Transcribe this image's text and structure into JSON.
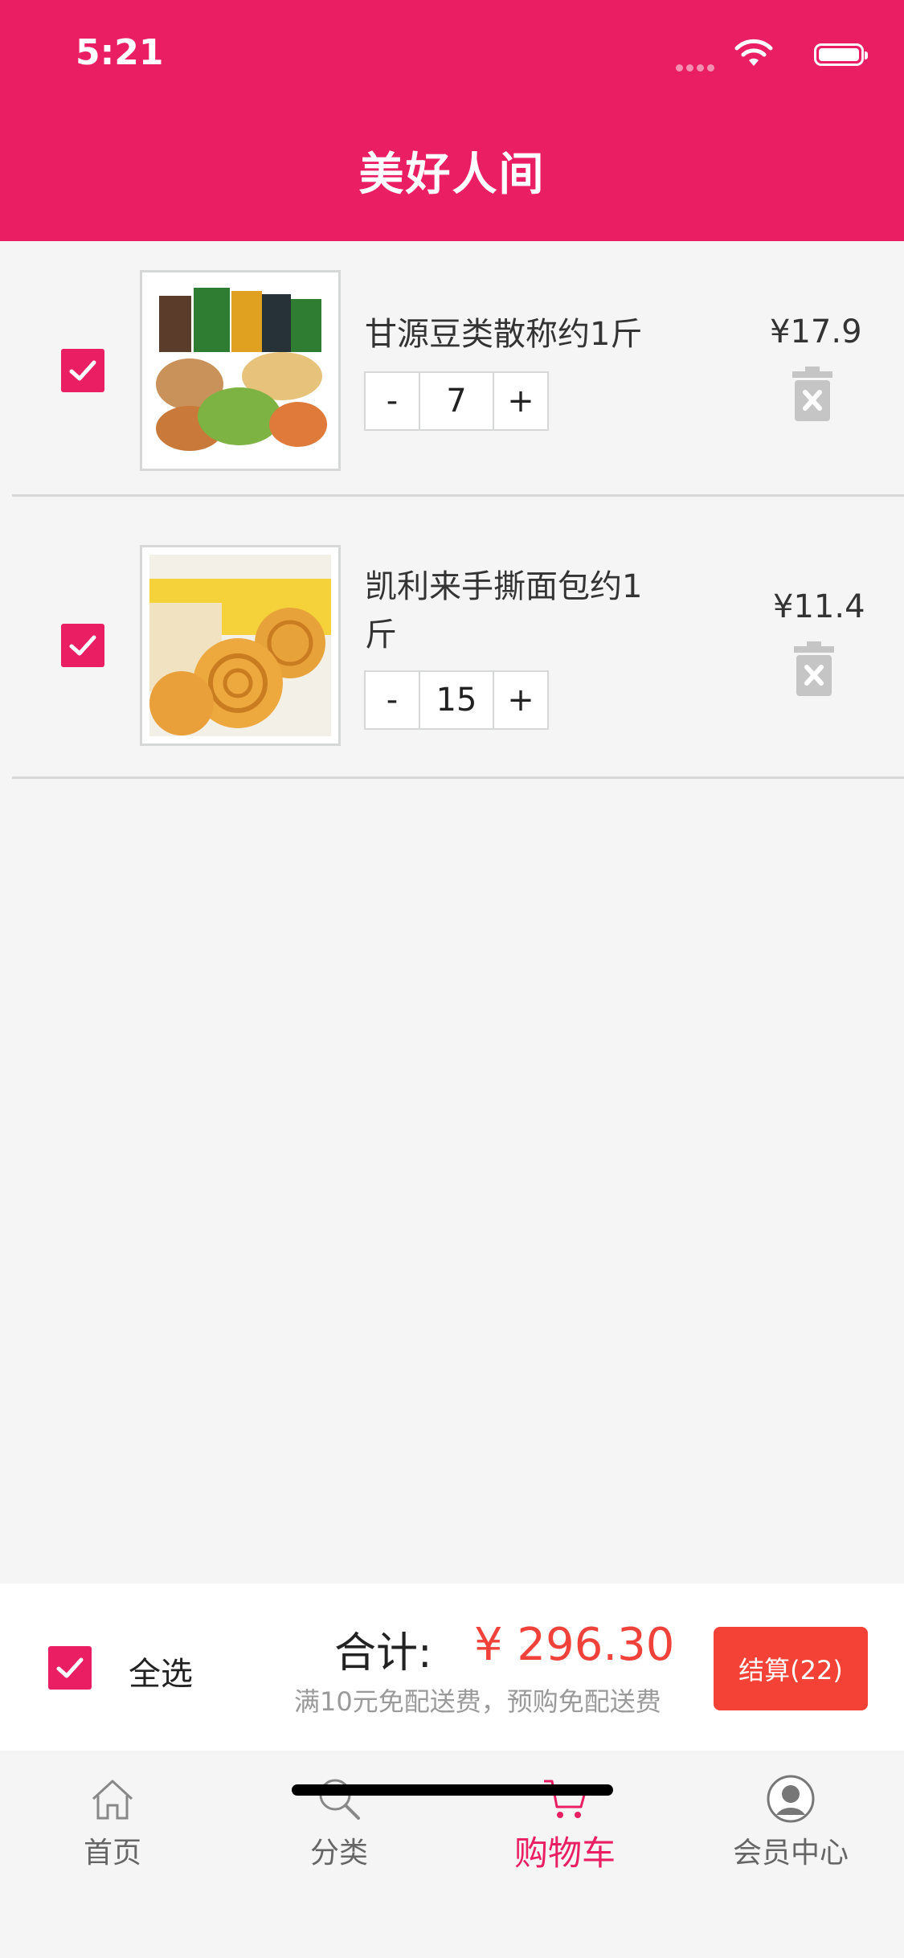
{
  "status_bar": {
    "time": "5:21"
  },
  "header": {
    "title": "美好人间"
  },
  "cart": {
    "items": [
      {
        "name": "甘源豆类散称约1斤",
        "quantity": "7",
        "price": "¥17.9",
        "checked": true,
        "image": "assorted-nuts-snack-bag"
      },
      {
        "name": "凯利来手撕面包约1斤",
        "quantity": "15",
        "price": "¥11.4",
        "checked": true,
        "image": "hand-torn-bread"
      }
    ],
    "minus_label": "-",
    "plus_label": "+"
  },
  "footer": {
    "select_all_label": "全选",
    "total_label": "合计:",
    "total_amount": "¥ 296.30",
    "shipping_note": "满10元免配送费，预购免配送费",
    "checkout_label": "结算(22)"
  },
  "tabbar": {
    "tabs": [
      {
        "label": "首页",
        "icon": "home-icon"
      },
      {
        "label": "分类",
        "icon": "search-icon"
      },
      {
        "label": "购物车",
        "icon": "cart-icon",
        "active": true
      },
      {
        "label": "会员中心",
        "icon": "user-icon"
      }
    ]
  },
  "colors": {
    "brand": "#ea1f63",
    "price_red": "#f0423a",
    "checkout_bg": "#f44336"
  }
}
